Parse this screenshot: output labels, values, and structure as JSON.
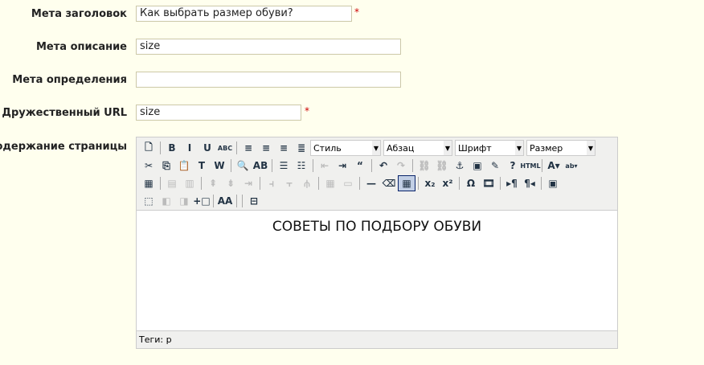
{
  "form": {
    "meta_title": {
      "label": "Мета заголовок",
      "value": "Как выбрать размер обуви?",
      "required": "*"
    },
    "meta_description": {
      "label": "Мета описание",
      "value": "size"
    },
    "meta_keywords": {
      "label": "Мета определения",
      "value": ""
    },
    "friendly_url": {
      "label": "Дружественный URL",
      "value": "size",
      "required": "*"
    },
    "content": {
      "label": "Содержание страницы"
    }
  },
  "editor": {
    "selects": {
      "style": "Стиль",
      "block": "Абзац",
      "font": "Шрифт",
      "size": "Размер"
    },
    "row1": [
      {
        "n": "new-document-icon",
        "g": "🗋"
      },
      {
        "s": 1
      },
      {
        "n": "bold-icon",
        "g": "B"
      },
      {
        "n": "italic-icon",
        "g": "I"
      },
      {
        "n": "underline-icon",
        "g": "U"
      },
      {
        "n": "strikethrough-icon",
        "g": "ABC"
      },
      {
        "s": 1
      },
      {
        "n": "align-left-icon",
        "g": "≡"
      },
      {
        "n": "align-center-icon",
        "g": "≡"
      },
      {
        "n": "align-right-icon",
        "g": "≡"
      },
      {
        "n": "align-justify-icon",
        "g": "≣"
      }
    ],
    "row2": [
      {
        "n": "cut-icon",
        "g": "✂"
      },
      {
        "n": "copy-icon",
        "g": "⎘"
      },
      {
        "n": "paste-icon",
        "g": "📋"
      },
      {
        "n": "paste-text-icon",
        "g": "T"
      },
      {
        "n": "paste-word-icon",
        "g": "W"
      },
      {
        "s": 1
      },
      {
        "n": "find-icon",
        "g": "🔍"
      },
      {
        "n": "replace-icon",
        "g": "AB"
      },
      {
        "s": 1
      },
      {
        "n": "bullet-list-icon",
        "g": "☰"
      },
      {
        "n": "numbered-list-icon",
        "g": "☷"
      },
      {
        "s": 1
      },
      {
        "n": "outdent-icon",
        "g": "⇤",
        "d": 1
      },
      {
        "n": "indent-icon",
        "g": "⇥"
      },
      {
        "n": "blockquote-icon",
        "g": "“"
      },
      {
        "s": 1
      },
      {
        "n": "undo-icon",
        "g": "↶"
      },
      {
        "n": "redo-icon",
        "g": "↷",
        "d": 1
      },
      {
        "s": 1
      },
      {
        "n": "link-icon",
        "g": "⛓",
        "d": 1
      },
      {
        "n": "unlink-icon",
        "g": "⛓",
        "d": 1
      },
      {
        "n": "anchor-icon",
        "g": "⚓"
      },
      {
        "n": "image-icon",
        "g": "▣"
      },
      {
        "n": "cleanup-icon",
        "g": "✎"
      },
      {
        "n": "help-icon",
        "g": "?"
      },
      {
        "n": "html-icon",
        "g": "HTML"
      },
      {
        "s": 1
      },
      {
        "n": "text-color-icon",
        "g": "A▾"
      },
      {
        "n": "highlight-color-icon",
        "g": "ab▾"
      }
    ],
    "row3": [
      {
        "n": "insert-table-icon",
        "g": "▦"
      },
      {
        "s": 1
      },
      {
        "n": "row-props-icon",
        "g": "▤",
        "d": 1
      },
      {
        "n": "cell-props-icon",
        "g": "▥",
        "d": 1
      },
      {
        "s": 1
      },
      {
        "n": "row-before-icon",
        "g": "⇞",
        "d": 1
      },
      {
        "n": "row-after-icon",
        "g": "⇟",
        "d": 1
      },
      {
        "n": "delete-row-icon",
        "g": "⇥",
        "d": 1
      },
      {
        "s": 1
      },
      {
        "n": "col-before-icon",
        "g": "⫞",
        "d": 1
      },
      {
        "n": "col-after-icon",
        "g": "⫟",
        "d": 1
      },
      {
        "n": "delete-col-icon",
        "g": "⫛",
        "d": 1
      },
      {
        "s": 1
      },
      {
        "n": "split-cells-icon",
        "g": "▦",
        "d": 1
      },
      {
        "n": "merge-cells-icon",
        "g": "▭",
        "d": 1
      },
      {
        "s": 1
      },
      {
        "n": "horizontal-rule-icon",
        "g": "—"
      },
      {
        "n": "remove-format-icon",
        "g": "⌫"
      },
      {
        "n": "visual-aid-icon",
        "g": "▦",
        "a": 1
      },
      {
        "s": 1
      },
      {
        "n": "subscript-icon",
        "g": "x₂"
      },
      {
        "n": "superscript-icon",
        "g": "x²"
      },
      {
        "s": 1
      },
      {
        "n": "special-char-icon",
        "g": "Ω"
      },
      {
        "n": "media-icon",
        "g": "🎞"
      },
      {
        "s": 1
      },
      {
        "n": "ltr-icon",
        "g": "▸¶"
      },
      {
        "n": "rtl-icon",
        "g": "¶◂"
      },
      {
        "s": 1
      },
      {
        "n": "fullscreen-icon",
        "g": "▣"
      }
    ],
    "row4": [
      {
        "n": "insert-layer-icon",
        "g": "⬚"
      },
      {
        "n": "move-forward-icon",
        "g": "◧",
        "d": 1
      },
      {
        "n": "move-backward-icon",
        "g": "◨",
        "d": 1
      },
      {
        "n": "absolute-icon",
        "g": "+□"
      },
      {
        "s": 1
      },
      {
        "n": "styles-icon",
        "g": "AA"
      },
      {
        "s": 1
      },
      {
        "s": 1
      },
      {
        "n": "page-break-icon",
        "g": "⊟"
      }
    ],
    "body_text": "СОВЕТЫ ПО ПОДБОРУ ОБУВИ",
    "status": "Теги: p"
  }
}
